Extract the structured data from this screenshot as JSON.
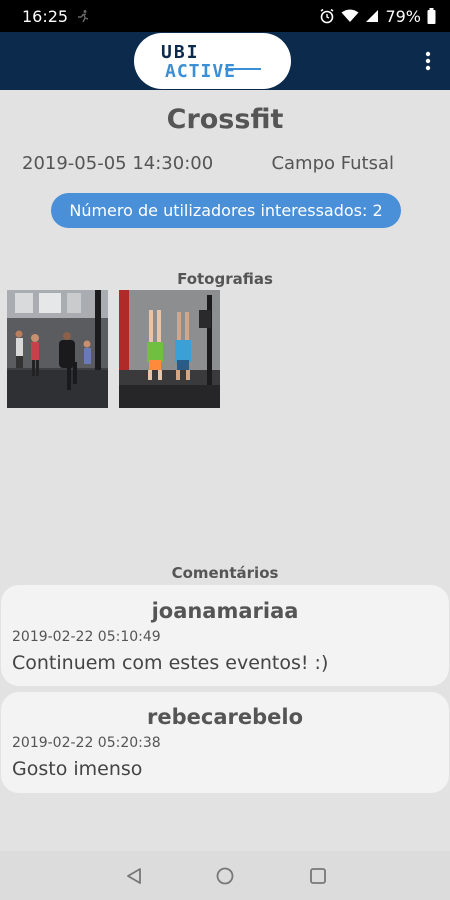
{
  "status_bar": {
    "time": "16:25",
    "battery_percent": "79%",
    "icons": [
      "running-icon",
      "alarm-icon",
      "wifi-icon",
      "signal-icon",
      "battery-icon"
    ]
  },
  "app_bar": {
    "logo_text_top": "UBI",
    "logo_text_bottom": "ACTIVE",
    "menu_icon": "more-vertical-icon",
    "brand_color": "#0c2b4c"
  },
  "event": {
    "title": "Crossfit",
    "datetime": "2019-05-05 14:30:00",
    "location": "Campo Futsal",
    "interested_label": "Número de utilizadores interessados: 2"
  },
  "photos": {
    "section_label": "Fotografias"
  },
  "comments": {
    "section_label": "Comentários",
    "items": [
      {
        "user": "joanamariaa",
        "date": "2019-02-22 05:10:49",
        "text": "Continuem com estes eventos! :)"
      },
      {
        "user": "rebecarebelo",
        "date": "2019-02-22 05:20:38",
        "text": "Gosto imenso"
      }
    ]
  },
  "nav_bar": {
    "icons": [
      "back-icon",
      "home-icon",
      "recents-icon"
    ]
  }
}
